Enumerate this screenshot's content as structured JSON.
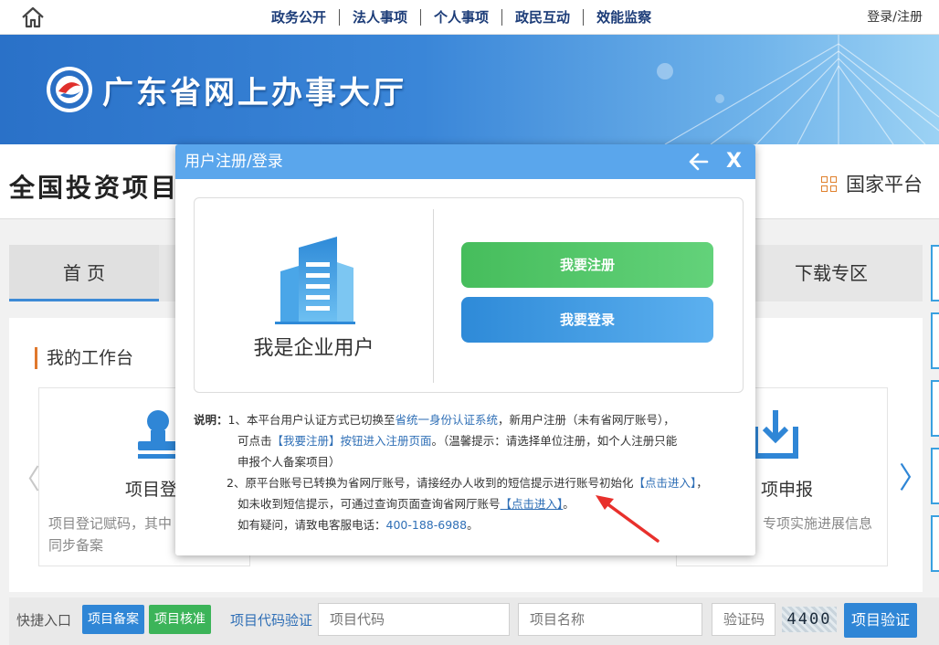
{
  "top_nav": {
    "items": [
      "政务公开",
      "法人事项",
      "个人事项",
      "政民互动",
      "效能监察"
    ],
    "login": "登录/注册"
  },
  "banner": {
    "title": "广东省网上办事大厅"
  },
  "page": {
    "title": "全国投资项目",
    "national_platform": "国家平台",
    "tabs": {
      "home": "首 页",
      "download": "下载专区"
    },
    "workspace_title": "我的工作台",
    "cards": [
      {
        "title": "项目登",
        "desc_line1": "项目登记赋码，其中",
        "desc_line2": "同步备案"
      },
      {
        "title": "项申报",
        "desc_line1": "专项实施进展信息"
      }
    ]
  },
  "bottom_bar": {
    "quick_label": "快捷入口",
    "quick_buttons": [
      "项目备案",
      "项目核准"
    ],
    "verify_label": "项目代码验证",
    "code_placeholder": "项目代码",
    "name_placeholder": "项目名称",
    "captcha_placeholder": "验证码",
    "captcha_value": "4400",
    "verify_button": "项目验证"
  },
  "modal": {
    "title": "用户注册/登录",
    "enterprise_label": "我是企业用户",
    "register_button": "我要注册",
    "login_button": "我要登录",
    "notes": {
      "label": "说明：",
      "n1_a": "1、本平台用户认证方式已切换至",
      "n1_link": "省统一身份认证系统",
      "n1_b": "，新用户注册（未有省网厅账号），",
      "n1_c": "可点击",
      "n1_link2": "【我要注册】按钮进入注册页面",
      "n1_d": "。（温馨提示：请选择单位注册，如个人注册只能",
      "n1_e": "申报个人备案项目）",
      "n2_a": "2、原平台账号已转换为省网厅账号，请接经办人收到的短信提示进行账号初始化",
      "n2_link": "【点击进入】",
      "n2_comma": "，",
      "n2_b": "如未收到短信提示，可通过查询页面查询省网厅账号",
      "n2_link2": "【点击进入】",
      "n2_end": "。",
      "n2_c": "如有疑问，请致电客服电话：",
      "phone": "400-188-6988",
      "period": "。"
    }
  },
  "colors": {
    "modal_header": "#5aa6ec",
    "register_green": "#46bd5c",
    "login_blue": "#2e8ad8",
    "accent_orange": "#e0782c"
  }
}
